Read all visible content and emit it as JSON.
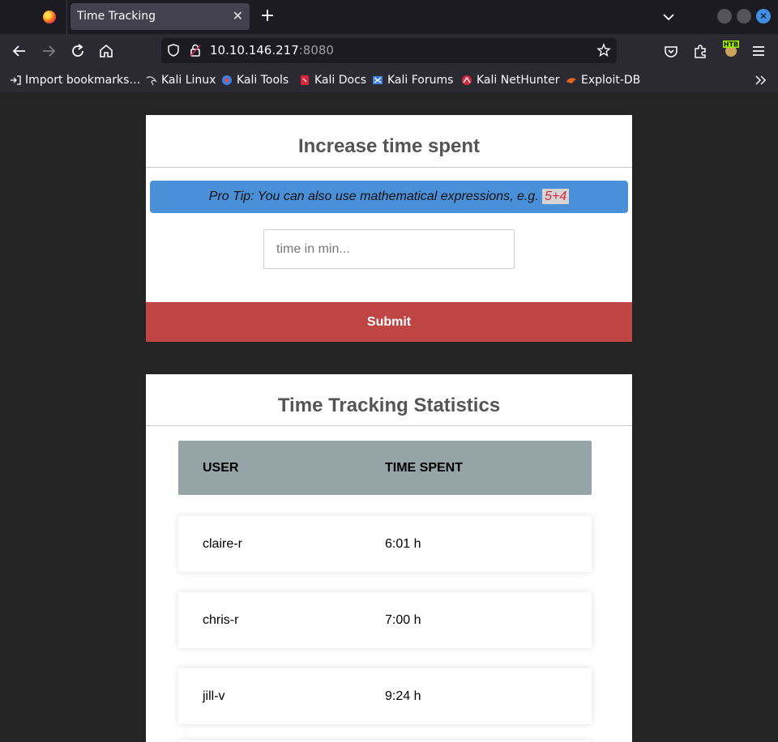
{
  "browser": {
    "tab_title": "Time Tracking",
    "tab_close": "✕",
    "new_tab": "+",
    "url_host": "10.10.146.217",
    "url_port": ":8080",
    "htb_label": "HTB",
    "bookmarks": [
      {
        "label": "Import bookmarks…",
        "icon": "import-icon"
      },
      {
        "label": "Kali Linux",
        "icon": "kali-dragon-icon"
      },
      {
        "label": "Kali Tools",
        "icon": "kali-tools-icon"
      },
      {
        "label": "Kali Docs",
        "icon": "kali-docs-icon"
      },
      {
        "label": "Kali Forums",
        "icon": "kali-forums-icon"
      },
      {
        "label": "Kali NetHunter",
        "icon": "nethunter-icon"
      },
      {
        "label": "Exploit-DB",
        "icon": "exploit-db-icon"
      }
    ]
  },
  "increase": {
    "title": "Increase time spent",
    "tip_text": "Pro Tip: You can also use mathematical expressions, e.g. ",
    "tip_example": "5+4",
    "input_placeholder": "time in min...",
    "input_value": "",
    "submit_label": "Submit"
  },
  "stats": {
    "title": "Time Tracking Statistics",
    "headers": [
      "USER",
      "TIME SPENT"
    ],
    "rows": [
      {
        "user": "claire-r",
        "time": "6:01 h"
      },
      {
        "user": "chris-r",
        "time": "7:00 h"
      },
      {
        "user": "jill-v",
        "time": "9:24 h"
      }
    ]
  },
  "colors": {
    "submit": "#bf4444",
    "tip": "#4a90d9",
    "table_header": "#95a4a6"
  }
}
